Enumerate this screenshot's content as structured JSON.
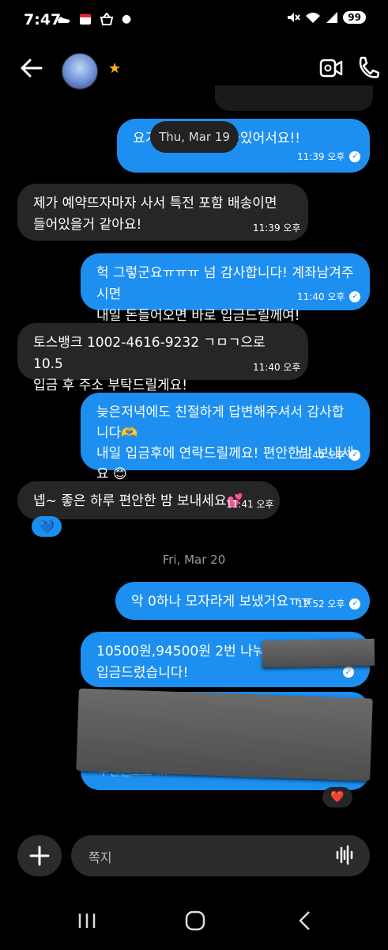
{
  "status_bar": {
    "time": "7:47",
    "left_icons": "⌁ ▣ ⌂ •",
    "battery": "99"
  },
  "header": {
    "verified_badge": "★"
  },
  "date_pill": "Thu, Mar 19",
  "messages": [
    {
      "side": "out",
      "lines": [
        "요기  팝이라고 나와있어서요!!"
      ],
      "time": "11:39 오후"
    },
    {
      "side": "in",
      "lines": [
        "제가 예약뜨자마자 사서 특전 포함 배송이면",
        "들어있을거 같아요!"
      ],
      "time": "11:39 오후"
    },
    {
      "side": "out",
      "lines": [
        "헉 그렇군요ㅠㅠㅠ 넘 감사합니다! 계좌남겨주시면",
        "내일 돈들어오면 바로 입금드릴께여!"
      ],
      "time": "11:40 오후"
    },
    {
      "side": "in",
      "lines": [
        "토스뱅크 1002-4616-9232 ㄱㅁㄱ으로 10.5",
        "입금 후 주소 부탁드릴게요!"
      ],
      "time": "11:40 오후"
    },
    {
      "side": "out",
      "lines": [
        "늦은저녁에도 친절하게 답변해주셔서 감사합니다🫶",
        "내일 입금후에 연락드릴께요! 편안한밤 보내세요 😊",
        "🫶"
      ],
      "time": "11:40 오후"
    },
    {
      "side": "in",
      "lines": [
        "넵~ 좋은 하루 편안한 밤 보내세요💕"
      ],
      "time": "11:41 오후"
    },
    {
      "side": "out",
      "lines": [
        "악 0하나 모자라게 보냈거요ㅠㅠ"
      ],
      "time": "12:52 오후"
    },
    {
      "side": "out",
      "lines": [
        "10500원,94500원 2번 나눠",
        "입금드렸습니다!"
      ],
      "time": ""
    },
    {
      "side": "out",
      "lines": [
        "우편번호로 ..."
      ],
      "time": ""
    }
  ],
  "reactions": {
    "blue_heart": "💙",
    "red_heart": "❤️"
  },
  "date_divider": "Fri, Mar 20",
  "composer": {
    "placeholder": "쪽지"
  },
  "colors": {
    "outgoing": "#1c8ff0",
    "incoming": "#262626",
    "background": "#000000"
  }
}
